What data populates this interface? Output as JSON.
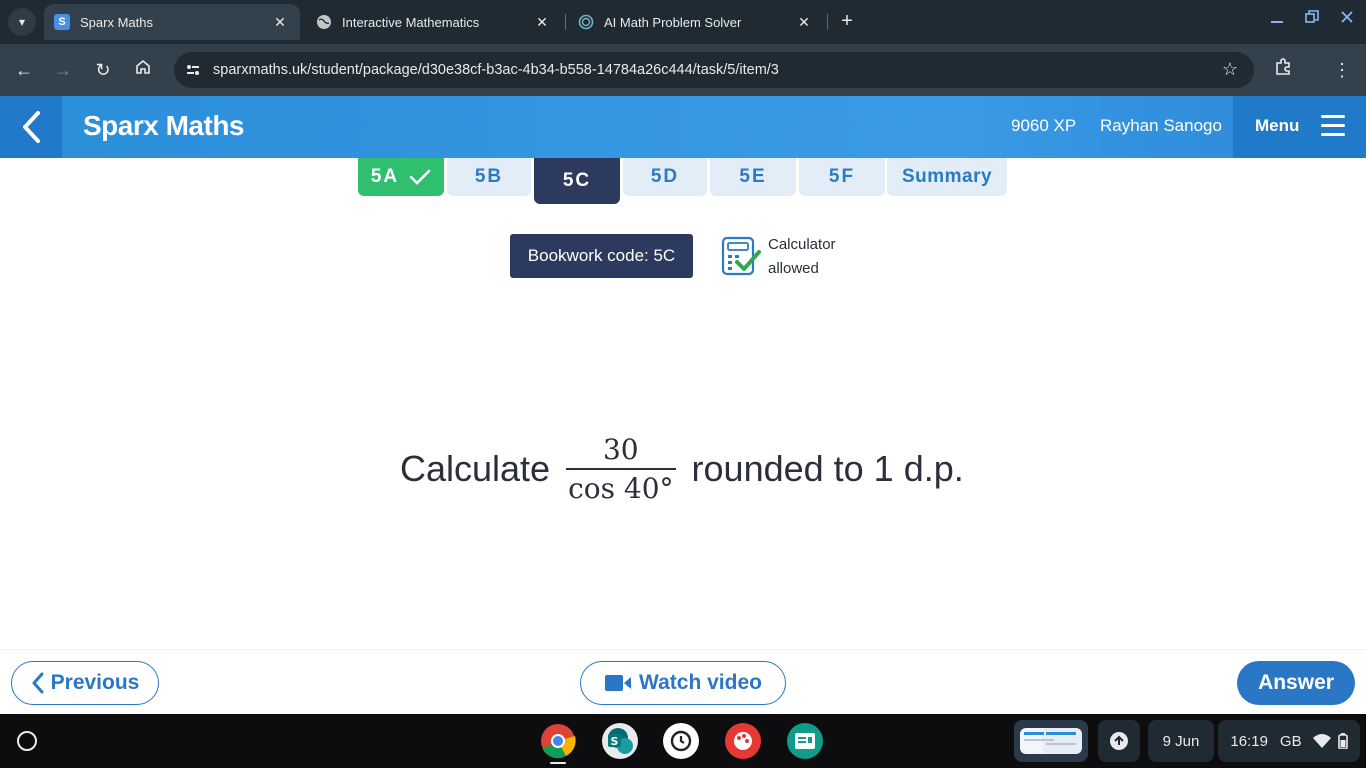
{
  "browser": {
    "tabs": [
      {
        "title": "Sparx Maths",
        "favicon": "S",
        "active": true
      },
      {
        "title": "Interactive Mathematics",
        "favicon": "globe-icon",
        "active": false
      },
      {
        "title": "AI Math Problem Solver",
        "favicon": "ring-icon",
        "active": false
      }
    ],
    "url": "sparxmaths.uk/student/package/d30e38cf-b3ac-4b34-b558-14784a26c444/task/5/item/3"
  },
  "header": {
    "brand": "Sparx Maths",
    "xp": "9060 XP",
    "user": "Rayhan Sanogo",
    "menu_label": "Menu"
  },
  "task_tabs": [
    {
      "label": "5A",
      "state": "done"
    },
    {
      "label": "5B",
      "state": "todo"
    },
    {
      "label": "5C",
      "state": "current"
    },
    {
      "label": "5D",
      "state": "todo"
    },
    {
      "label": "5E",
      "state": "todo"
    },
    {
      "label": "5F",
      "state": "todo"
    },
    {
      "label": "Summary",
      "state": "todo"
    }
  ],
  "bookwork": {
    "code_label": "Bookwork code: 5C",
    "calc_line1": "Calculator",
    "calc_line2": "allowed"
  },
  "question": {
    "prefix": "Calculate",
    "numerator": "30",
    "denominator": "cos 40°",
    "suffix": "rounded to 1 d.p."
  },
  "footer": {
    "previous": "Previous",
    "watch_video": "Watch video",
    "answer": "Answer"
  },
  "shelf": {
    "date": "9 Jun",
    "time": "16:19",
    "region": "GB"
  },
  "colors": {
    "sparx_blue": "#2b8ed9",
    "done_green": "#2fbf6f",
    "current_navy": "#2b3a5e",
    "button_blue": "#2a78c5"
  }
}
